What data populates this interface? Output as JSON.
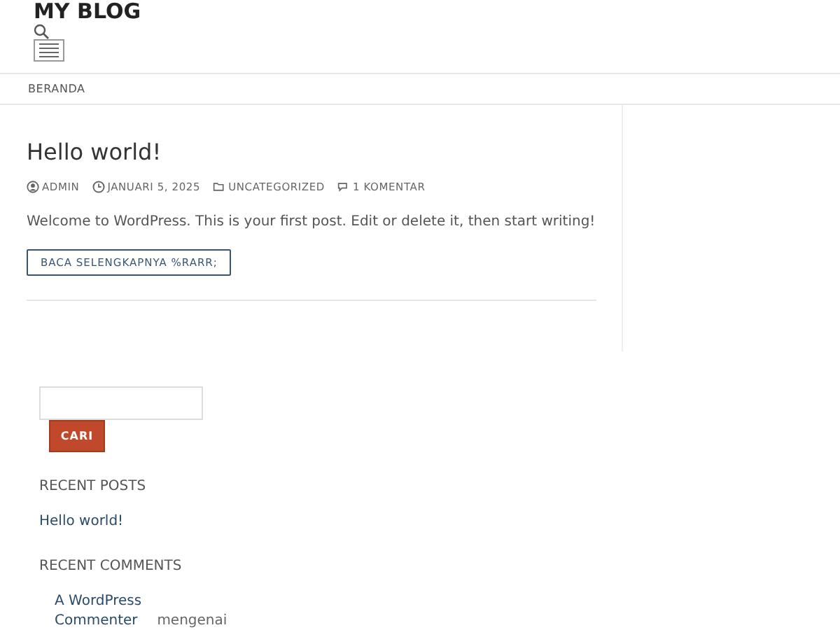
{
  "site_title": "MY BLOG",
  "nav": [
    {
      "label": "BERANDA",
      "selected": false
    }
  ],
  "post": {
    "title": "Hello world!",
    "meta": [
      {
        "kind": "author",
        "text": "ADMIN"
      },
      {
        "kind": "date",
        "text": "JANUARI 5, 2025"
      },
      {
        "kind": "category",
        "text": "UNCATEGORIZED"
      },
      {
        "kind": "comments",
        "text": "1 KOMENTAR"
      }
    ],
    "excerpt": "Welcome to WordPress. This is your first post. Edit or delete it, then start writing!",
    "read_more": "BACA SELENGKAPNYA %RARR;"
  },
  "search": {
    "button": "CARI"
  },
  "recent_posts": {
    "heading": "RECENT POSTS",
    "items": [
      "Hello world!"
    ]
  },
  "recent_comments": {
    "heading": "RECENT COMMENTS",
    "items": [
      {
        "author": "A WordPress Commenter",
        "text": "mengenai"
      }
    ]
  }
}
